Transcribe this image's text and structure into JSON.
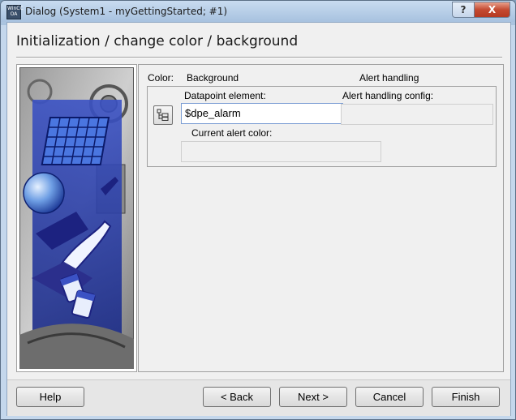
{
  "window": {
    "title": "Dialog (System1 - myGettingStarted; #1)",
    "icon_text": "WinCC OA",
    "help_glyph": "?",
    "close_glyph": "X"
  },
  "page": {
    "title": "Initialization / change color / background"
  },
  "panel": {
    "color_label": "Color:",
    "background_label": "Background",
    "alert_handling_label": "Alert handling",
    "datapoint_label": "Datapoint element:",
    "datapoint_value": "$dpe_alarm",
    "alert_config_label": "Alert handling config:",
    "current_alert_color_label": "Current alert color:"
  },
  "buttons": {
    "help": "Help",
    "back": "< Back",
    "next": "Next >",
    "cancel": "Cancel",
    "finish": "Finish"
  },
  "colors": {
    "accent_blue": "#2a3b9c",
    "close_red": "#c44a31"
  }
}
